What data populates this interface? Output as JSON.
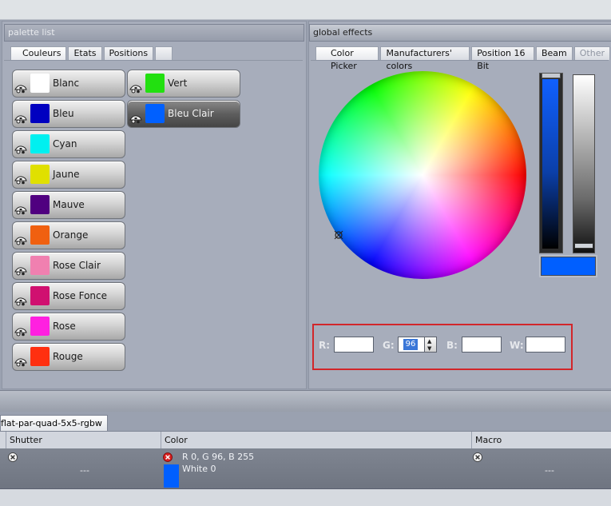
{
  "palette": {
    "title": "palette list",
    "tabs": [
      {
        "label": "Couleurs"
      },
      {
        "label": "Etats"
      },
      {
        "label": "Positions"
      },
      {
        "label": ""
      }
    ],
    "colors": [
      {
        "label": "Blanc",
        "color": "#ffffff"
      },
      {
        "label": "Vert",
        "color": "#22e010"
      },
      {
        "label": "Bleu",
        "color": "#0000c0"
      },
      {
        "label": "Bleu Clair",
        "color": "#0060ff",
        "selected": true
      },
      {
        "label": "Cyan",
        "color": "#00f0f0"
      },
      {
        "label": "Jaune",
        "color": "#e0e000"
      },
      {
        "label": "Mauve",
        "color": "#500080"
      },
      {
        "label": "Orange",
        "color": "#f06010"
      },
      {
        "label": "Rose Clair",
        "color": "#f080b0"
      },
      {
        "label": "Rose Fonce",
        "color": "#d01070"
      },
      {
        "label": "Rose",
        "color": "#ff20e0"
      },
      {
        "label": "Rouge",
        "color": "#ff3010"
      }
    ]
  },
  "effects": {
    "title": "global effects",
    "tabs": [
      {
        "label": "Color Picker"
      },
      {
        "label": "Manufacturers' colors"
      },
      {
        "label": "Position 16 Bit"
      },
      {
        "label": "Beam"
      },
      {
        "label": "Other"
      }
    ],
    "fields": {
      "r_label": "R:",
      "g_label": "G:",
      "b_label": "B:",
      "w_label": "W:",
      "g_value": "96"
    },
    "preview_color": "#005fff"
  },
  "fixture": {
    "tab_label": "flat-par-quad-5x5-rgbw",
    "columns": {
      "shutter": "Shutter",
      "color": "Color",
      "macro": "Macro"
    },
    "row": {
      "shutter_value": "---",
      "color_line1": "R 0, G 96, B 255",
      "color_line2": "White 0",
      "macro_value": "---",
      "color_swatch": "#005fff"
    }
  }
}
